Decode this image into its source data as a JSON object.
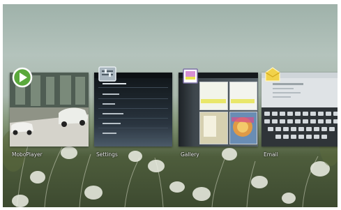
{
  "recents": {
    "apps": [
      {
        "label": "MoboPlayer"
      },
      {
        "label": "Settings"
      },
      {
        "label": "Gallery"
      },
      {
        "label": "Email"
      }
    ]
  },
  "colors": {
    "label_text": "#f4f6f2",
    "settings_panel": "#1a2228",
    "email_panel": "#dfe3e6"
  },
  "icons": [
    "moboplayer-play-icon",
    "settings-app-icon",
    "gallery-app-icon",
    "email-app-icon"
  ]
}
